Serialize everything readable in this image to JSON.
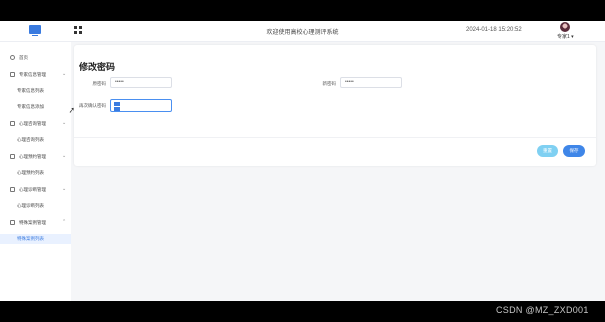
{
  "header": {
    "system_title": "欢迎使用高校心理测评系统",
    "datetime": "2024-01-18 15:20:52",
    "user": "专家1 ▾"
  },
  "sidebar": {
    "items": [
      {
        "label": "首页",
        "type": "item",
        "icon": "clock-icon"
      },
      {
        "label": "专家信息管理",
        "type": "group",
        "icon": "list-icon"
      },
      {
        "label": "专家信息列表",
        "type": "sub"
      },
      {
        "label": "专家信息添加",
        "type": "sub"
      },
      {
        "label": "心理咨询管理",
        "type": "group",
        "icon": "list-icon"
      },
      {
        "label": "心理咨询列表",
        "type": "sub"
      },
      {
        "label": "心理预约管理",
        "type": "group",
        "icon": "list-icon"
      },
      {
        "label": "心理预约列表",
        "type": "sub"
      },
      {
        "label": "心理诊断管理",
        "type": "group",
        "icon": "list-icon"
      },
      {
        "label": "心理诊断列表",
        "type": "sub"
      },
      {
        "label": "特殊案例管理",
        "type": "group",
        "icon": "list-icon"
      },
      {
        "label": "特殊案例列表",
        "type": "sub",
        "active": true
      }
    ]
  },
  "form": {
    "title": "修改密码",
    "old_password_label": "原密码",
    "old_password_value": "•••••",
    "new_password_label": "新密码",
    "new_password_value": "•••••",
    "confirm_password_label": "再次确认密码",
    "confirm_password_value": "",
    "reset_label": "重置",
    "save_label": "保存"
  },
  "watermark": "CSDN @MZ_ZXD001",
  "colors": {
    "accent": "#3f86e8",
    "reset_button": "#7fd0f2",
    "active_nav_bg": "#e9f1ff"
  }
}
